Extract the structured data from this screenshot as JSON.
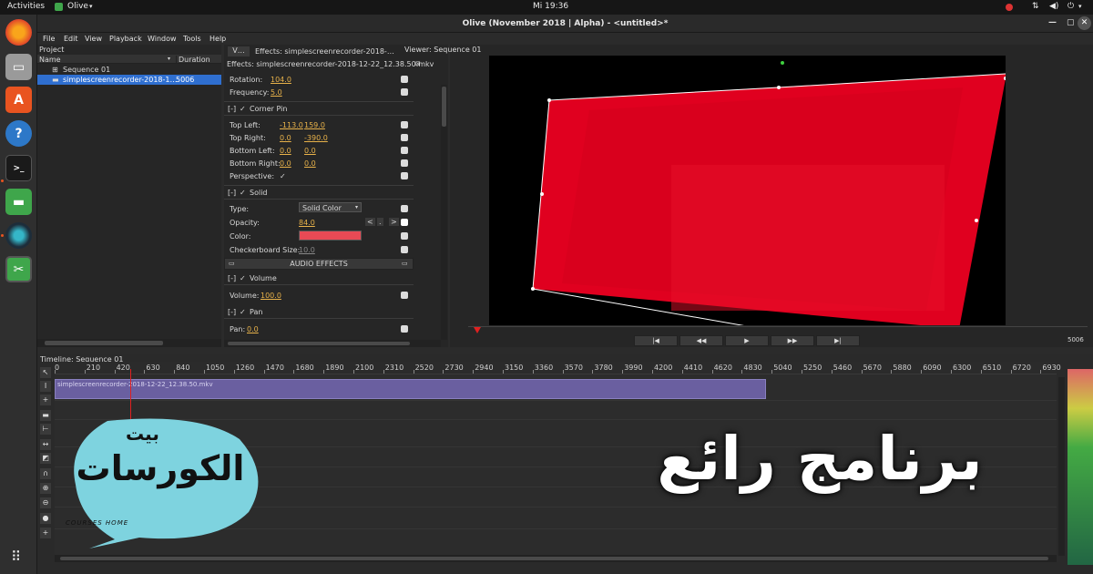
{
  "system": {
    "activities": "Activities",
    "app_name": "Olive",
    "clock": "Mi 19:36"
  },
  "window": {
    "title": "Olive (November 2018 | Alpha) - <untitled>*"
  },
  "menu": [
    "File",
    "Edit",
    "View",
    "Playback",
    "Window",
    "Tools",
    "Help"
  ],
  "project": {
    "title": "Project",
    "col_name": "Name",
    "col_duration": "Duration",
    "sequence": "Sequence 01",
    "clip": "simplescreenrecorder-2018-1…",
    "clip_duration": "5006"
  },
  "effects": {
    "tab_v": "V…",
    "tab_effects": "Effects: simplescreenrecorder-2018-…",
    "header": "Effects: simplescreenrecorder-2018-12-22_12.38.50.mkv",
    "rotation_label": "Rotation:",
    "rotation_val": "104.0",
    "frequency_label": "Frequency:",
    "frequency_val": "5.0",
    "corner_pin": "Corner Pin",
    "top_left_label": "Top Left:",
    "top_left_x": "-113.0",
    "top_left_y": "159.0",
    "top_right_label": "Top Right:",
    "top_right_x": "0.0",
    "top_right_y": "-390.0",
    "bottom_left_label": "Bottom Left:",
    "bottom_left_x": "0.0",
    "bottom_left_y": "0.0",
    "bottom_right_label": "Bottom Right:",
    "bottom_right_x": "0.0",
    "bottom_right_y": "0.0",
    "perspective_label": "Perspective:",
    "solid": "Solid",
    "type_label": "Type:",
    "type_val": "Solid Color",
    "opacity_label": "Opacity:",
    "opacity_val": "84.0",
    "color_label": "Color:",
    "checker_label": "Checkerboard Size:",
    "checker_val": "10.0",
    "audio_effects": "AUDIO EFFECTS",
    "volume": "Volume",
    "volume_label": "Volume:",
    "volume_val": "100.0",
    "pan": "Pan",
    "pan_label": "Pan:",
    "pan_val": "0.0",
    "collapse": "[-]",
    "check": "✓"
  },
  "viewer": {
    "title": "Viewer: Sequence 01",
    "timecode": "5006"
  },
  "timeline": {
    "title": "Timeline: Sequence 01",
    "clip": "simplescreenrecorder-2018-12-22_12.38.50.mkv",
    "ticks": [
      "0",
      "210",
      "420",
      "630",
      "840",
      "1050",
      "1260",
      "1470",
      "1680",
      "1890",
      "2100",
      "2310",
      "2520",
      "2730",
      "2940",
      "3150",
      "3360",
      "3570",
      "3780",
      "3990",
      "4200",
      "4410",
      "4620",
      "4830",
      "5040",
      "5250",
      "5460",
      "5670",
      "5880",
      "6090",
      "6300",
      "6510",
      "6720",
      "6930"
    ]
  },
  "overlay": {
    "logo_top": "بيت",
    "logo_main": "الكورسات",
    "logo_sub": "COURSES HOME",
    "headline": "برنامج رائع"
  },
  "colors": {
    "accent_orange": "#e95420",
    "clip_purple": "#6a5fa0",
    "frame_red": "#e0001f",
    "value_yellow": "#e8b24a",
    "overlay_teal": "#7ed3df"
  }
}
